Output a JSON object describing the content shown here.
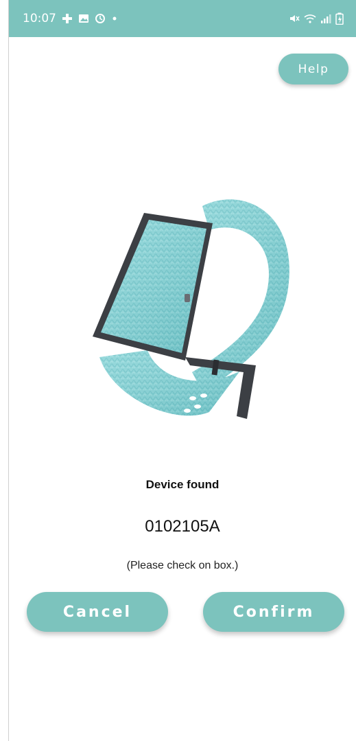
{
  "status_bar": {
    "time": "10:07",
    "left_icons": [
      "health-plus-icon",
      "gallery-icon",
      "alarm-icon",
      "dot-icon"
    ],
    "right_icons": [
      "mute-icon",
      "wifi-icon",
      "signal-icon",
      "battery-charging-icon"
    ]
  },
  "header": {
    "help_label": "Help"
  },
  "device": {
    "image_icon": "fitness-band-image",
    "status_text": "Device found",
    "id": "0102105A",
    "note": "(Please check on box.)"
  },
  "actions": {
    "cancel_label": "Cancel",
    "confirm_label": "Confirm"
  },
  "colors": {
    "accent": "#7cc3bd",
    "band": "#86d3d6",
    "band_dark": "#5fb7bc",
    "buckle": "#3c3f44"
  }
}
